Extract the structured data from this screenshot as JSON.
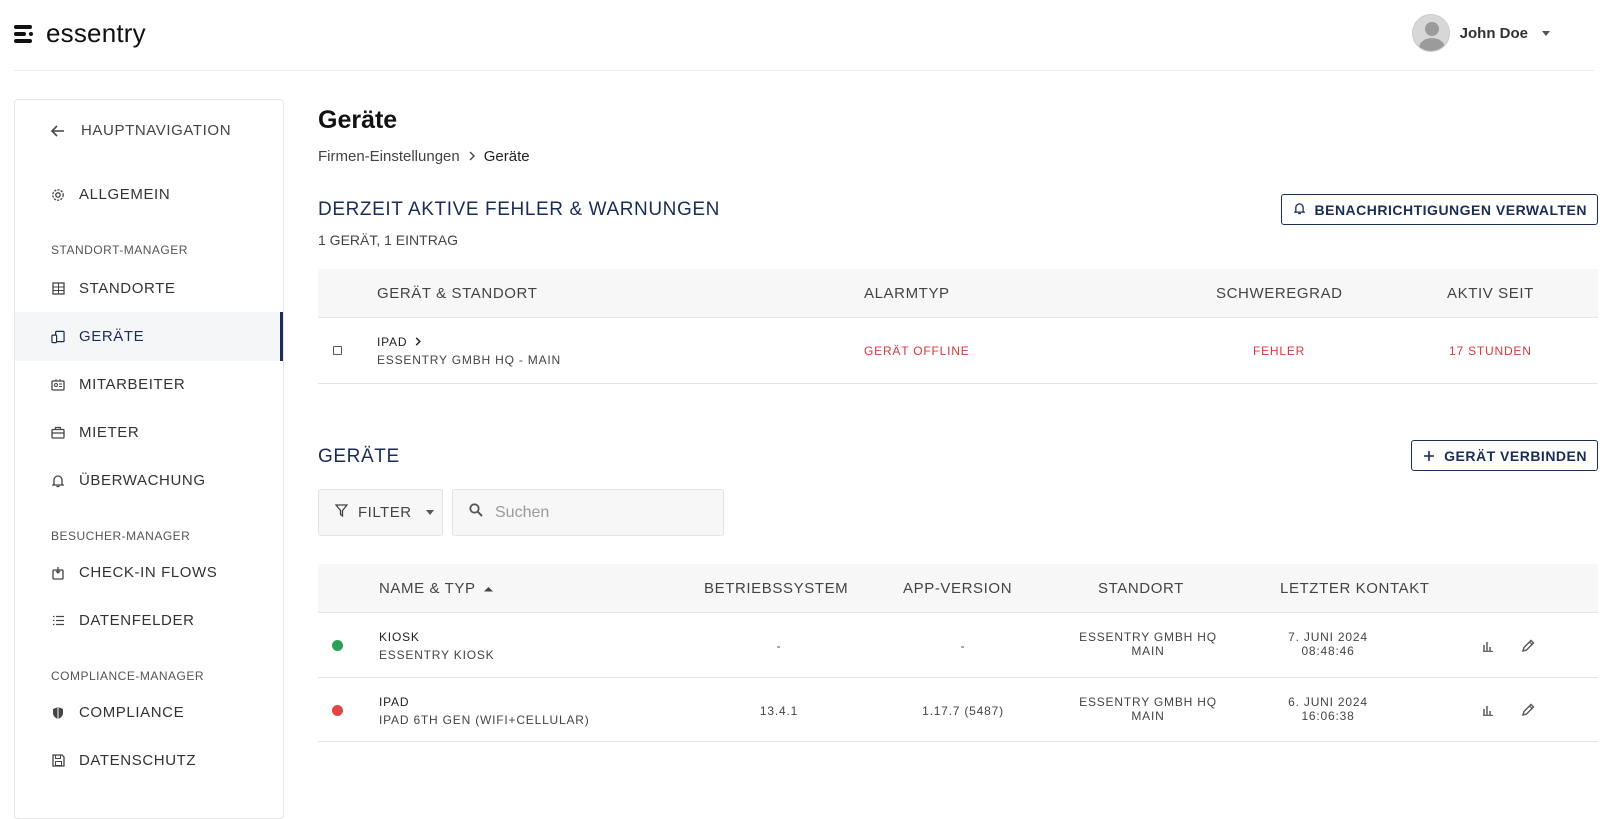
{
  "header": {
    "logo_text": "essentry",
    "user_name": "John Doe"
  },
  "sidebar": {
    "back_label": "HAUPTNAVIGATION",
    "general": "ALLGEMEIN",
    "sections": {
      "standort": "STANDORT-MANAGER",
      "besucher": "BESUCHER-MANAGER",
      "compliance": "COMPLIANCE-MANAGER"
    },
    "items": {
      "standorte": "STANDORTE",
      "geraete": "GERÄTE",
      "mitarbeiter": "MITARBEITER",
      "mieter": "MIETER",
      "ueberwachung": "ÜBERWACHUNG",
      "checkin": "CHECK-IN FLOWS",
      "datenfelder": "DATENFELDER",
      "compliance": "COMPLIANCE",
      "datenschutz": "DATENSCHUTZ"
    }
  },
  "page": {
    "title": "Geräte",
    "breadcrumb_parent": "Firmen-Einstellungen",
    "breadcrumb_current": "Geräte"
  },
  "alerts": {
    "title": "DERZEIT AKTIVE FEHLER & WARNUNGEN",
    "subtitle": "1 GERÄT, 1 EINTRAG",
    "manage_button": "BENACHRICHTIGUNGEN VERWALTEN",
    "columns": {
      "device": "GERÄT & STANDORT",
      "alarm": "ALARMTYP",
      "severity": "SCHWEREGRAD",
      "since": "AKTIV SEIT"
    },
    "rows": [
      {
        "device": "IPAD",
        "location": "ESSENTRY GMBH HQ - MAIN",
        "alarm": "GERÄT OFFLINE",
        "severity": "FEHLER",
        "since": "17 STUNDEN"
      }
    ]
  },
  "devices": {
    "title": "GERÄTE",
    "connect_button": "GERÄT VERBINDEN",
    "filter_label": "FILTER",
    "search_placeholder": "Suchen",
    "columns": {
      "name": "NAME & TYP",
      "os": "BETRIEBSSYSTEM",
      "app": "APP-VERSION",
      "location": "STANDORT",
      "contact": "LETZTER KONTAKT"
    },
    "rows": [
      {
        "name": "KIOSK",
        "type": "ESSENTRY KIOSK",
        "status_color": "#2e9e5b",
        "os": "-",
        "app": "-",
        "location_line1": "ESSENTRY GMBH HQ",
        "location_line2": "MAIN",
        "contact_date": "7. JUNI 2024",
        "contact_time": "08:48:46"
      },
      {
        "name": "IPAD",
        "type": "IPAD 6TH GEN (WIFI+CELLULAR)",
        "status_color": "#e04646",
        "os": "13.4.1",
        "app": "1.17.7 (5487)",
        "location_line1": "ESSENTRY GMBH HQ",
        "location_line2": "MAIN",
        "contact_date": "6. JUNI 2024",
        "contact_time": "16:06:38"
      }
    ]
  }
}
